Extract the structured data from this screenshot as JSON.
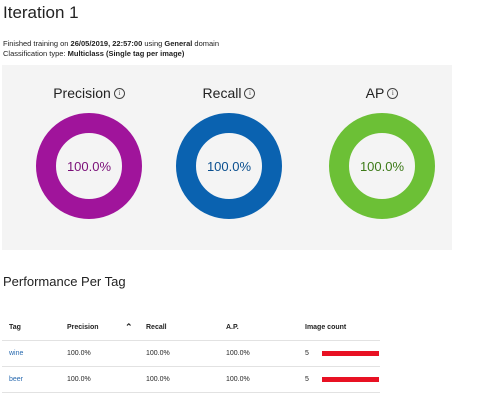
{
  "page": {
    "title": "Iteration 1",
    "training_line": {
      "prefix": "Finished training on ",
      "datetime": "26/05/2019, 22:57:00",
      "middle": " using ",
      "domain": "General",
      "suffix": " domain"
    },
    "classification_line": {
      "prefix": "Classification type: ",
      "value": "Multiclass (Single tag per image)"
    }
  },
  "metrics": [
    {
      "label": "Precision",
      "value": "100.0%",
      "fraction": 1.0,
      "color": "#a0149b",
      "text_color": "#7a0f78"
    },
    {
      "label": "Recall",
      "value": "100.0%",
      "fraction": 1.0,
      "color": "#0a62b0",
      "text_color": "#0a4f8f"
    },
    {
      "label": "AP",
      "value": "100.0%",
      "fraction": 1.0,
      "color": "#6cc036",
      "text_color": "#3d7a18"
    }
  ],
  "performance": {
    "section_title": "Performance Per Tag",
    "columns": {
      "tag": "Tag",
      "precision": "Precision",
      "recall": "Recall",
      "ap": "A.P.",
      "image_count": "Image count"
    },
    "sort_icon": "chevron-up-icon",
    "bar_color": "#e81123",
    "rows": [
      {
        "tag": "wine",
        "precision": "100.0%",
        "recall": "100.0%",
        "ap": "100.0%",
        "image_count": "5",
        "bar_fraction": 1.0
      },
      {
        "tag": "beer",
        "precision": "100.0%",
        "recall": "100.0%",
        "ap": "100.0%",
        "image_count": "5",
        "bar_fraction": 1.0
      }
    ]
  }
}
